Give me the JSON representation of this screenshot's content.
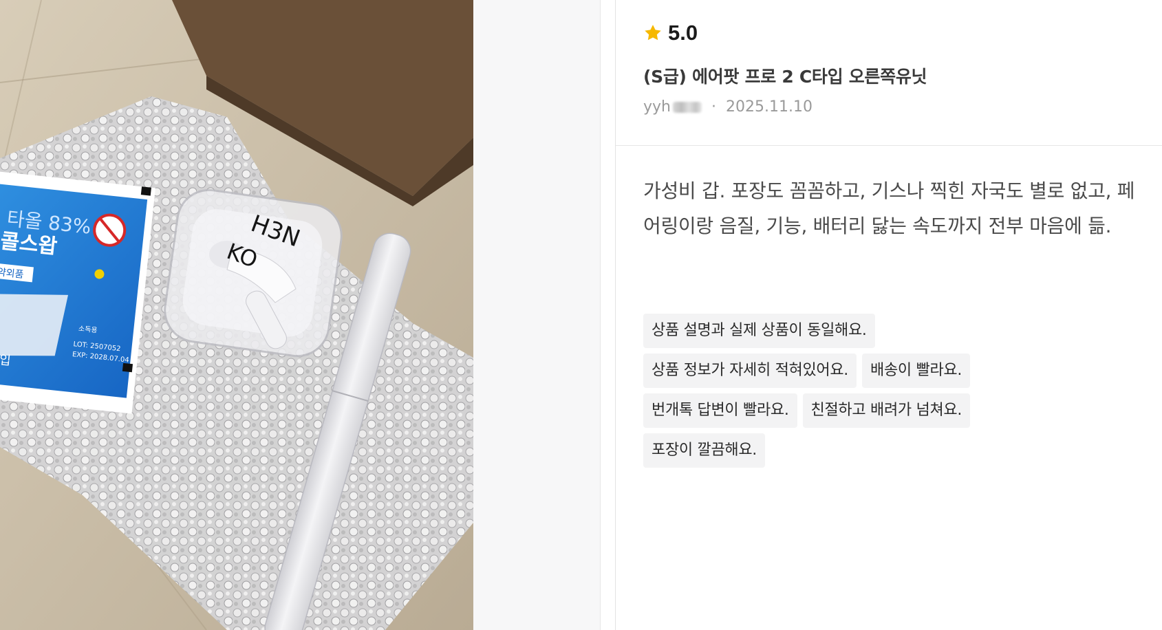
{
  "photo": {
    "packet_text": [
      "타올 83%",
      "콜스왑",
      "약외품",
      "소독용",
      "LOT: 2507052",
      "EXP: 2028.07.04",
      "매입"
    ],
    "case_marking": [
      "H3N",
      "KO"
    ]
  },
  "review": {
    "rating": "5.0",
    "star_color": "#f6b800",
    "product_title": "(S급) 에어팟 프로 2 C타입 오른쪽유닛",
    "author_visible": "yyh",
    "separator": "·",
    "date": "2025.11.10",
    "body": "가성비 갑. 포장도 꼼꼼하고, 기스나 찍힌 자국도 별로 없고, 페어링이랑 음질, 기능, 배터리 닳는 속도까지 전부 마음에 듦.",
    "tags": [
      "상품 설명과 실제 상품이 동일해요.",
      "상품 정보가 자세히 적혀있어요.",
      "배송이 빨라요.",
      "번개톡 답변이 빨라요.",
      "친절하고 배려가 넘쳐요.",
      "포장이 깔끔해요."
    ]
  }
}
